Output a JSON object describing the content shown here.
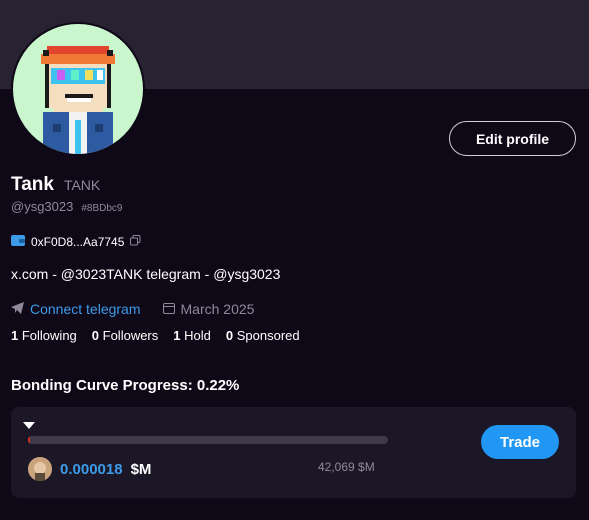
{
  "profile": {
    "name": "Tank",
    "ticker": "TANK",
    "handle": "@ysg3023",
    "hash": "#8BDbc9",
    "wallet": "0xF0D8...Aa7745",
    "bio": "x.com - @3023TANK telegram - @ysg3023",
    "connect_telegram": "Connect telegram",
    "joined": "March 2025",
    "edit_label": "Edit profile"
  },
  "stats": [
    {
      "count": "1",
      "label": "Following"
    },
    {
      "count": "0",
      "label": "Followers"
    },
    {
      "count": "1",
      "label": "Hold"
    },
    {
      "count": "0",
      "label": "Sponsored"
    }
  ],
  "bonding": {
    "title": "Bonding Curve Progress: 0.22%",
    "progress_percent": 0.22,
    "amount": "0.000018",
    "unit": "$M",
    "market_cap": "42,069 $M",
    "trade_label": "Trade"
  },
  "colors": {
    "accent": "#2196f3",
    "link": "#3d9be9",
    "progress": "#e02a2a"
  }
}
